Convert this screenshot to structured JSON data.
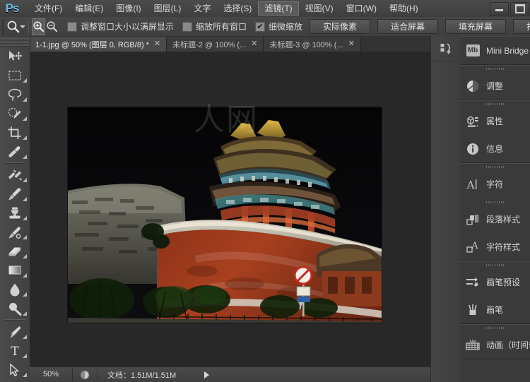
{
  "app": {
    "logo": "Ps",
    "menus": [
      {
        "label": "文件(F)",
        "active": false
      },
      {
        "label": "编辑(E)",
        "active": false
      },
      {
        "label": "图像(I)",
        "active": false
      },
      {
        "label": "图层(L)",
        "active": false
      },
      {
        "label": "文字",
        "active": false
      },
      {
        "label": "选择(S)",
        "active": false
      },
      {
        "label": "滤镜(T)",
        "active": true
      },
      {
        "label": "视图(V)",
        "active": false
      },
      {
        "label": "窗口(W)",
        "active": false
      },
      {
        "label": "帮助(H)",
        "active": false
      }
    ],
    "window_controls": [
      {
        "name": "minimize",
        "glyph": "—"
      },
      {
        "name": "maximize",
        "glyph": "▭"
      }
    ]
  },
  "options_bar": {
    "tool_icon": "zoom-tool-icon",
    "zoom_in_label": "放大",
    "zoom_out_label": "缩小",
    "checkboxes": [
      {
        "label": "调整窗口大小以满屏显示",
        "checked": false
      },
      {
        "label": "缩放所有窗口",
        "checked": false
      },
      {
        "label": "细微缩放",
        "checked": true
      }
    ],
    "buttons": [
      {
        "label": "实际像素"
      },
      {
        "label": "适合屏幕"
      },
      {
        "label": "填充屏幕"
      },
      {
        "label": "打印尺寸"
      }
    ]
  },
  "tabs": [
    {
      "label": "1-1.jpg @ 50% (图层 0, RGB/8) *",
      "close": "✕",
      "active": true
    },
    {
      "label": "未标题-2 @ 100% (...",
      "close": "✕",
      "active": false
    },
    {
      "label": "未标题-3 @ 100% (...",
      "close": "✕",
      "active": false
    }
  ],
  "toolbar": {
    "tools": [
      {
        "name": "move-tool",
        "has_submenu": false
      },
      {
        "name": "rectangular-marquee-tool",
        "has_submenu": true
      },
      {
        "name": "lasso-tool",
        "has_submenu": true
      },
      {
        "name": "quick-selection-tool",
        "has_submenu": true
      },
      {
        "name": "crop-tool",
        "has_submenu": true
      },
      {
        "name": "eyedropper-tool",
        "has_submenu": true
      },
      {
        "name": "spot-healing-brush-tool",
        "has_submenu": true
      },
      {
        "name": "brush-tool",
        "has_submenu": true
      },
      {
        "name": "clone-stamp-tool",
        "has_submenu": true
      },
      {
        "name": "history-brush-tool",
        "has_submenu": true
      },
      {
        "name": "eraser-tool",
        "has_submenu": true
      },
      {
        "name": "gradient-tool",
        "has_submenu": true
      },
      {
        "name": "blur-tool",
        "has_submenu": true
      },
      {
        "name": "dodge-tool",
        "has_submenu": true
      },
      {
        "name": "pen-tool",
        "has_submenu": true
      },
      {
        "name": "type-tool",
        "has_submenu": true
      },
      {
        "name": "path-selection-tool",
        "has_submenu": true
      }
    ]
  },
  "document": {
    "image_alt": "夜景故宫角楼红墙照片",
    "watermark": "人网",
    "status": {
      "zoom": "50%",
      "doc_info": "文档：1.51M/1.51M",
      "arrow": "▶"
    }
  },
  "dock": {
    "collapse_icon": "collapse-panels-icon",
    "sections": [
      {
        "items": [
          {
            "label": "Mini Bridge",
            "icon": "mini-bridge-icon",
            "badge": "Mb"
          }
        ]
      },
      {
        "items": [
          {
            "label": "调整",
            "icon": "adjustments-icon"
          }
        ]
      },
      {
        "items": [
          {
            "label": "属性",
            "icon": "properties-icon"
          },
          {
            "label": "信息",
            "icon": "info-icon"
          }
        ]
      },
      {
        "items": [
          {
            "label": "字符",
            "icon": "character-icon"
          }
        ]
      },
      {
        "items": [
          {
            "label": "段落样式",
            "icon": "paragraph-styles-icon"
          },
          {
            "label": "字符样式",
            "icon": "character-styles-icon"
          }
        ]
      },
      {
        "items": [
          {
            "label": "画笔预设",
            "icon": "brush-presets-icon"
          },
          {
            "label": "画笔",
            "icon": "brush-icon"
          }
        ]
      },
      {
        "items": [
          {
            "label": "动画（时间轴",
            "icon": "animation-timeline-icon"
          }
        ]
      }
    ]
  },
  "colors": {
    "chrome": "#434343",
    "panel": "#3a3a3a",
    "canvas_bg": "#282828",
    "accent": "#6fb8e0",
    "text": "#d4d4d4"
  }
}
